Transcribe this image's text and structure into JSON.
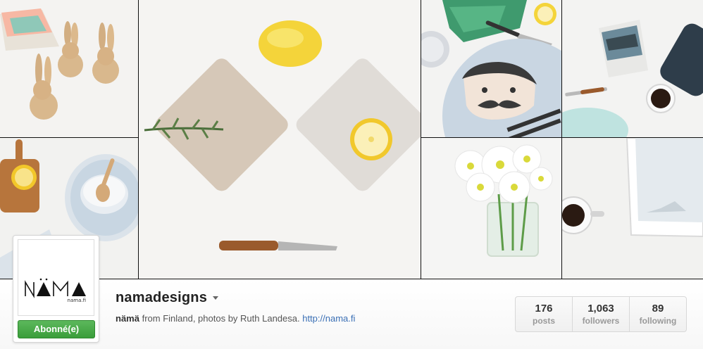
{
  "profile": {
    "username": "namadesigns",
    "logo_text": "NÄMA",
    "logo_subtext": "nama.fi",
    "follow_label": "Abonné(e)",
    "bio": {
      "name": "nämä",
      "text": " from Finland, photos by Ruth Landesa. ",
      "link": "http://nama.fi"
    }
  },
  "stats": [
    {
      "value": "176",
      "label": "posts"
    },
    {
      "value": "1,063",
      "label": "followers"
    },
    {
      "value": "89",
      "label": "following"
    }
  ],
  "colors": {
    "follow_button": "#4cae4c",
    "link": "#3a6fb5"
  }
}
